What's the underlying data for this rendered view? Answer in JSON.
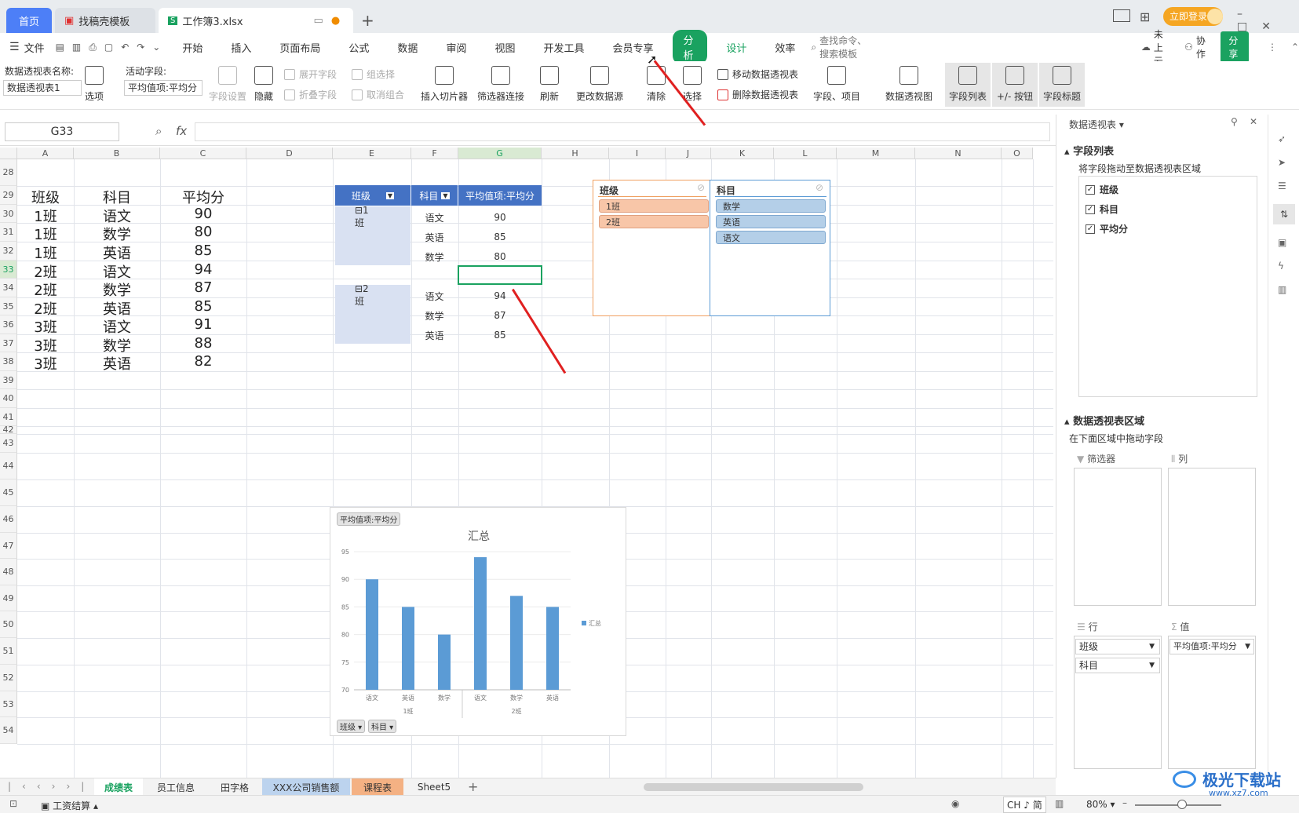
{
  "tabs": {
    "home": "首页",
    "template": "找稿壳模板",
    "doc": "工作簿3.xlsx",
    "login": "立即登录"
  },
  "menu": {
    "file": "文件",
    "items": [
      "开始",
      "插入",
      "页面布局",
      "公式",
      "数据",
      "审阅",
      "视图",
      "开发工具",
      "会员专享"
    ],
    "analyze": "分析",
    "design": "设计",
    "efficiency": "效率",
    "search": "查找命令、搜索模板",
    "cloud": "未上云",
    "collab": "协作",
    "share": "分享"
  },
  "ribbon": {
    "pt_name_label": "数据透视表名称:",
    "pt_name_value": "数据透视表1",
    "options": "选项",
    "active_field_label": "活动字段:",
    "active_field_value": "平均值项:平均分",
    "field_settings": "字段设置",
    "hide": "隐藏",
    "expand": "展开字段",
    "collapse": "折叠字段",
    "group_sel": "组选择",
    "ungroup": "取消组合",
    "insert_slicer": "插入切片器",
    "filter_conn": "筛选器连接",
    "refresh": "刷新",
    "change_source": "更改数据源",
    "clear": "清除",
    "select": "选择",
    "move_pt": "移动数据透视表",
    "delete_pt": "删除数据透视表",
    "fields_items": "字段、项目",
    "pivot_chart": "数据透视图",
    "field_list": "字段列表",
    "plus_minus": "+/- 按钮",
    "field_headers": "字段标题"
  },
  "formula": {
    "cell_ref": "G33",
    "fx": "fx",
    "value": ""
  },
  "grid": {
    "columns": [
      "A",
      "B",
      "C",
      "D",
      "E",
      "F",
      "G",
      "H",
      "I",
      "J",
      "K",
      "L",
      "M",
      "N",
      "O"
    ],
    "rows": [
      "28",
      "29",
      "30",
      "31",
      "32",
      "33",
      "34",
      "35",
      "36",
      "37",
      "38",
      "39",
      "40",
      "41",
      "42",
      "43",
      "44",
      "45",
      "46",
      "47",
      "48",
      "49",
      "50",
      "51",
      "52",
      "53",
      "54"
    ],
    "source_header": [
      "班级",
      "科目",
      "平均分"
    ],
    "source_rows": [
      [
        "1班",
        "语文",
        "90"
      ],
      [
        "1班",
        "数学",
        "80"
      ],
      [
        "1班",
        "英语",
        "85"
      ],
      [
        "2班",
        "语文",
        "94"
      ],
      [
        "2班",
        "数学",
        "87"
      ],
      [
        "2班",
        "英语",
        "85"
      ],
      [
        "3班",
        "语文",
        "91"
      ],
      [
        "3班",
        "数学",
        "88"
      ],
      [
        "3班",
        "英语",
        "82"
      ]
    ]
  },
  "pivot": {
    "h1": "班级",
    "h2": "科目",
    "h3": "平均值项:平均分",
    "g1": "⊟1班",
    "g2": "⊟2班",
    "r1": [
      [
        "语文",
        "90"
      ],
      [
        "英语",
        "85"
      ],
      [
        "数学",
        "80"
      ]
    ],
    "r2": [
      [
        "语文",
        "94"
      ],
      [
        "数学",
        "87"
      ],
      [
        "英语",
        "85"
      ]
    ]
  },
  "slicer_class": {
    "title": "班级",
    "items": [
      "1班",
      "2班"
    ]
  },
  "slicer_subject": {
    "title": "科目",
    "items": [
      "数学",
      "英语",
      "语文"
    ]
  },
  "chart_data": {
    "type": "bar",
    "title": "汇总",
    "value_field_button": "平均值项:平均分",
    "categories": [
      "语文",
      "英语",
      "数学",
      "语文",
      "数学",
      "英语"
    ],
    "groups": [
      "1班",
      "2班"
    ],
    "series": [
      {
        "name": "汇总",
        "values": [
          90,
          85,
          80,
          94,
          87,
          85
        ]
      }
    ],
    "ylim": [
      70,
      95
    ],
    "yticks": [
      "70",
      "75",
      "80",
      "85",
      "90",
      "95"
    ],
    "field_buttons": [
      "班级",
      "科目"
    ],
    "legend": "right",
    "color": "#5b9bd5"
  },
  "panel": {
    "title": "数据透视表",
    "field_list": "字段列表",
    "drag_hint": "将字段拖动至数据透视表区域",
    "fields": [
      "班级",
      "科目",
      "平均分"
    ],
    "area_title": "数据透视表区域",
    "area_hint": "在下面区域中拖动字段",
    "filter": "筛选器",
    "cols": "列",
    "rows_label": "行",
    "values_label": "值",
    "row_fields": [
      "班级",
      "科目"
    ],
    "value_fields": [
      "平均值项:平均分"
    ]
  },
  "sheets": [
    "成绩表",
    "员工信息",
    "田字格",
    "XXX公司销售额",
    "课程表",
    "Sheet5"
  ],
  "status": {
    "calc": "工资结算",
    "ime": "CH ♪ 简",
    "zoom": "80%"
  },
  "watermark": {
    "text": "极光下载站",
    "url": "www.xz7.com"
  }
}
